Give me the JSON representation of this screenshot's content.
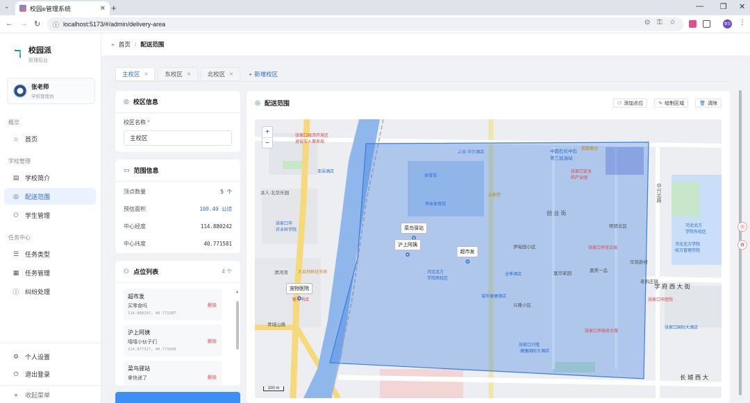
{
  "browser": {
    "tab_title": "校园e管理系统",
    "url": "localhost:5173/#/admin/delivery-area",
    "profile": "李华"
  },
  "sidebar": {
    "brand": "校园派",
    "brand_sub": "管理后台",
    "user": {
      "name": "张老师",
      "role": "学校管理员"
    },
    "groups": [
      {
        "label": "概览"
      },
      {
        "label": "学校管理"
      },
      {
        "label": "任务中心"
      }
    ],
    "items": [
      {
        "label": "首页",
        "icon": "home-icon"
      },
      {
        "label": "学校简介",
        "icon": "building-icon"
      },
      {
        "label": "配送范围",
        "icon": "location-icon",
        "active": true
      },
      {
        "label": "学生管理",
        "icon": "user-icon"
      },
      {
        "label": "任务类型",
        "icon": "list-icon"
      },
      {
        "label": "任务管理",
        "icon": "doc-icon"
      },
      {
        "label": "纠纷处理",
        "icon": "alert-icon"
      }
    ],
    "bottom": [
      {
        "label": "个人设置",
        "icon": "gear-icon"
      },
      {
        "label": "退出登录",
        "icon": "power-icon"
      },
      {
        "label": "收起菜单",
        "icon": "collapse-icon"
      }
    ]
  },
  "breadcrumb": {
    "home": "首页",
    "current": "配送范围"
  },
  "campus_tabs": [
    "主校区",
    "东校区",
    "北校区"
  ],
  "add_campus": "新增校区",
  "campus_info": {
    "title": "校区信息",
    "name_label": "校区名称",
    "name_value": "主校区"
  },
  "range_info": {
    "title": "范围信息",
    "rows": [
      {
        "k": "顶点数量",
        "v": "5 个"
      },
      {
        "k": "预估面积",
        "v": "109.49 公顷"
      },
      {
        "k": "中心经度",
        "v": "114.880242"
      },
      {
        "k": "中心纬度",
        "v": "40.771581"
      }
    ]
  },
  "points": {
    "title": "点位列表",
    "count": "4 个",
    "delete_label": "删除",
    "items": [
      {
        "name": "超市发",
        "addr": "买零食吗",
        "coord": "114.888207, 40.771387"
      },
      {
        "name": "沪上阿姨",
        "addr": "嘻嘻小伙子们",
        "coord": "114.877327, 40.771648"
      },
      {
        "name": "菜鸟驿站",
        "addr": "拿快递了",
        "coord": ""
      }
    ]
  },
  "map_card": {
    "title": "配送范围",
    "tools": [
      "添加点位",
      "绘制区域",
      "清除"
    ],
    "markers": [
      "菜鸟驿站",
      "沪上阿姨",
      "超市发",
      "宠物医院"
    ],
    "scale": "100 m"
  },
  "map_labels": {
    "streets": [
      "创 业 街",
      "学 府 西 大 街",
      "长 城 西 大",
      "中兴北路",
      "老鸦庄镇",
      "伊甸园小区",
      "富华家园",
      "嘉美一品",
      "兴隆小区",
      "明德北区",
      "华苑新村",
      "清河湾",
      "青城山路",
      "关人·北华乐园",
      "中国石化中石\n第三加油站"
    ],
    "pois": [
      "张家口经济开发区\n退役军人事务局",
      "亚朵酒店",
      "张家口市\n农业科学院",
      "上谷·华尔酒店",
      "体育馆",
      "李本体育馆",
      "云朝堂",
      "张家口安太\n药产业园",
      "张家口市信访局",
      "河北北方\n学院西校区",
      "全季酒店",
      "城市便捷酒店",
      "张家口兴隆\n·健康国际大酒店",
      "张家口市政府大楼",
      "张家口国际大酒店",
      "张家口市医院",
      "大自然鲜花市场",
      "新华书店",
      "鹏鹏集团",
      "河北北方\n学院东校区",
      "河北北方学院\n校方管理学院"
    ]
  },
  "colors": {
    "accent": "#2d6bd6",
    "danger": "#e04848",
    "polygon_fill": "#3b7ddd",
    "river": "#8fb7ec"
  }
}
